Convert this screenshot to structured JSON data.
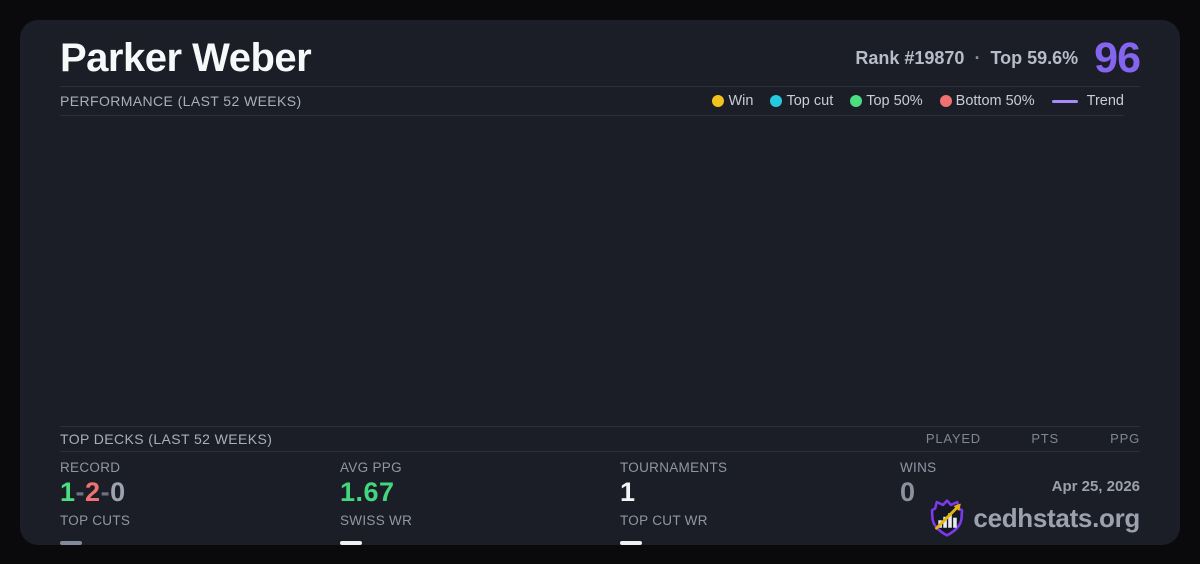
{
  "colors": {
    "background": "#0a0a0d",
    "card_bg": "#1b1e27",
    "accent_purple": "#8565f0",
    "green": "#4ade80",
    "red": "#f07171",
    "gray_value": "#9ca3af",
    "separator_gray": "#6b7280",
    "dash_gray": "#828a99",
    "dash_white": "#eef0f4",
    "brand_purple": "#7c3aed",
    "brand_gold": "#e8b60b"
  },
  "header": {
    "player_name": "Parker Weber",
    "rank": "Rank #19870",
    "dot_separator": "·",
    "top_percent": "Top 59.6%",
    "score": "96"
  },
  "performance": {
    "title": "PERFORMANCE (LAST 52 WEEKS)",
    "legend": [
      {
        "label": "Win",
        "color": "#f2c21d"
      },
      {
        "label": "Top cut",
        "color": "#25cade"
      },
      {
        "label": "Top 50%",
        "color": "#4ade80"
      },
      {
        "label": "Bottom 50%",
        "color": "#f07171"
      }
    ],
    "trend": {
      "label": "Trend",
      "color": "#a78bfa"
    },
    "chart_empty": true
  },
  "top_decks": {
    "title": "TOP DECKS (LAST 52 WEEKS)",
    "columns": [
      "PLAYED",
      "PTS",
      "PPG"
    ]
  },
  "stats": {
    "record": {
      "label": "RECORD",
      "wins": "1",
      "losses": "2",
      "draws": "0",
      "separator": "-",
      "wins_color": "#4ade80",
      "losses_color": "#f07171",
      "draws_color": "#9ca3af",
      "separator_color": "#6b7280"
    },
    "avg_ppg": {
      "label": "AVG PPG",
      "value": "1.67",
      "color": "#42d77d"
    },
    "tournaments": {
      "label": "TOURNAMENTS",
      "value": "1",
      "color": "#f3f4f6"
    },
    "wins": {
      "label": "WINS",
      "value": "0",
      "color": "#8b919d"
    },
    "top_cuts": {
      "label": "TOP CUTS",
      "value": "—",
      "dash_color": "#828a99"
    },
    "swiss_wr": {
      "label": "SWISS WR",
      "value": "—",
      "dash_color": "#eef0f4"
    },
    "top_cut_wr": {
      "label": "TOP CUT WR",
      "value": "—",
      "dash_color": "#eef0f4"
    }
  },
  "footer": {
    "date": "Apr 25, 2026",
    "site": "cedhstats.org"
  }
}
